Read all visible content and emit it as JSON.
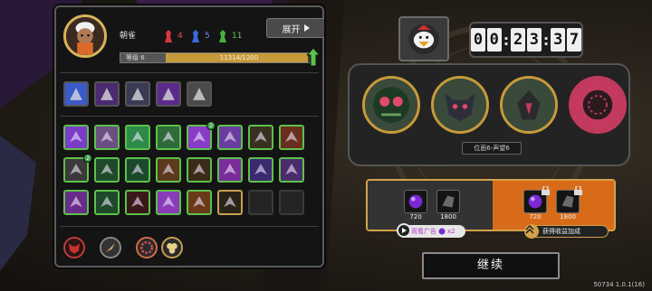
{
  "player": {
    "name": "朝雀",
    "stats": {
      "red": "4",
      "blue": "5",
      "green": "11"
    },
    "level_label": "等级 6",
    "level_progress_text": "11314/1200",
    "level_fill_fraction": 0.97,
    "level_up_badge": "2",
    "expand_label": "展开"
  },
  "top_items": [
    {
      "icon": "spear-icon"
    },
    {
      "icon": "rune-chest-icon"
    },
    {
      "icon": "bear-paw-icon"
    },
    {
      "icon": "dagger-icon"
    },
    {
      "icon": "robot-helmet-icon"
    }
  ],
  "skills": [
    {
      "icon": "bat-icon",
      "color": "#7b3cc8"
    },
    {
      "icon": "armor-icon",
      "color": "#6a5080"
    },
    {
      "icon": "diamond-sigil-icon",
      "color": "#2e8a4a"
    },
    {
      "icon": "holy-cross-icon",
      "color": "#2e6a3a",
      "badge": ""
    },
    {
      "icon": "purple-beam-icon",
      "color": "#8a3cc8",
      "badge": "2"
    },
    {
      "icon": "eye-rune-icon",
      "color": "#6a3ca0"
    },
    {
      "icon": "tent-icon",
      "color": "#3a3020"
    },
    {
      "icon": "orange-slash-icon",
      "color": "#6a2e1e"
    },
    {
      "icon": "target-icon",
      "color": "#3a3a3a",
      "badge": "2"
    },
    {
      "icon": "green-arrows-icon",
      "color": "#1e4a2a"
    },
    {
      "icon": "claw-icon",
      "color": "#1a4a2a"
    },
    {
      "icon": "gold-scratch-icon",
      "color": "#5a3a1a"
    },
    {
      "icon": "wheat-icon",
      "color": "#3a2a18"
    },
    {
      "icon": "spiral-icon",
      "color": "#7a2c9a"
    },
    {
      "icon": "dual-blade-icon",
      "color": "#3a2a70"
    },
    {
      "icon": "needle-spray-icon",
      "color": "#4a2c6a"
    },
    {
      "icon": "swirl-crystal-icon",
      "color": "#6a2c8a"
    },
    {
      "icon": "thorn-vine-icon",
      "color": "#1e4a2a"
    },
    {
      "icon": "red-aura-icon",
      "color": "#3a1818"
    },
    {
      "icon": "phantom-mask-icon",
      "color": "#8a3cb8"
    },
    {
      "icon": "gold-gear-icon",
      "color": "#6a3a18"
    },
    {
      "icon": "gold-disc-icon",
      "color": "#2a2418"
    },
    {
      "icon": "empty-slot-icon",
      "color": "#242424"
    },
    {
      "icon": "empty-slot-icon",
      "color": "#242424"
    }
  ],
  "bottom_buttons": [
    {
      "icon": "red-demon-icon"
    },
    {
      "icon": "compass-icon"
    },
    {
      "icon": "red-gear-icon"
    },
    {
      "icon": "cluster-icon"
    }
  ],
  "timer": [
    "0",
    "0",
    "2",
    "3",
    "3",
    "7"
  ],
  "enemy_panel": {
    "position_label": "位面6-声望6",
    "enemies": [
      {
        "icon": "spider-icon"
      },
      {
        "icon": "demon-face-icon"
      },
      {
        "icon": "insect-icon"
      },
      {
        "icon": "rose-blob-icon"
      }
    ]
  },
  "rewards": {
    "free_items": [
      {
        "icon": "purple-orb-icon",
        "count": "720"
      },
      {
        "icon": "gem-icon",
        "count": "1800"
      }
    ],
    "bonus_items": [
      {
        "icon": "purple-orb-icon",
        "count": "720"
      },
      {
        "icon": "gem-icon",
        "count": "1800"
      }
    ],
    "watch_ad_label": "观看广告",
    "watch_ad_multiplier": "x2",
    "gain_boost_label": "获得收益加成"
  },
  "continue_label": "继续",
  "version": "50734 1.0.1(16)",
  "colors": {
    "accent_gold": "#c79a3a",
    "reward_orange": "#d86b1a",
    "frame_green": "#5cc24a"
  }
}
